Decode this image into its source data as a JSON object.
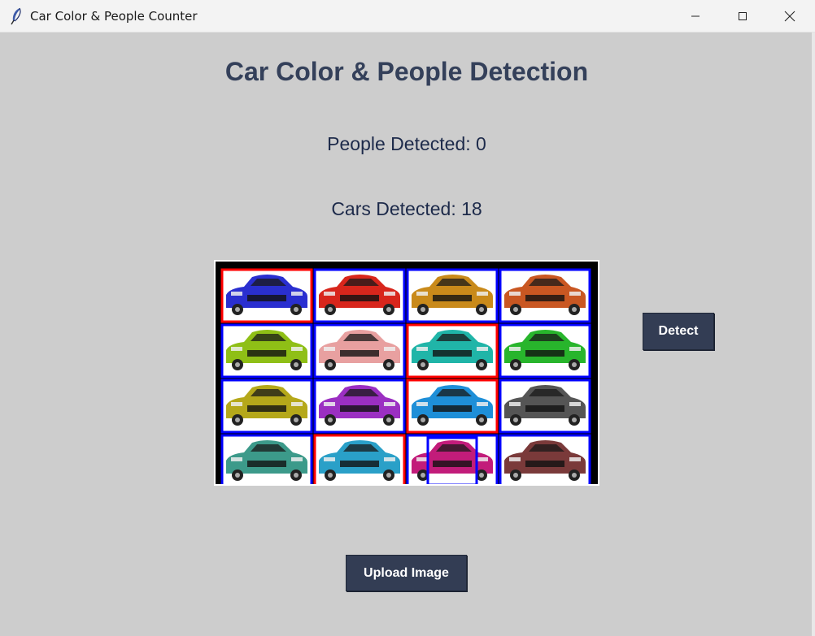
{
  "window": {
    "title": "Car Color & People Counter",
    "app_icon": "feather-icon",
    "controls": [
      "minimize-icon",
      "maximize-icon",
      "close-icon"
    ]
  },
  "main": {
    "heading": "Car Color & People Detection",
    "people_label": "People Detected: 0",
    "cars_label": "Cars Detected: 18",
    "detect_button": "Detect",
    "upload_button": "Upload Image"
  },
  "colors": {
    "background": "#cdcdcd",
    "heading": "#34405a",
    "button_bg": "#333d54",
    "button_text": "#ffffff",
    "box_red": "#ff0000",
    "box_blue": "#0000ff"
  },
  "image": {
    "car_colors": [
      [
        "#2a2fd0",
        "#d8261c",
        "#c98a1a",
        "#c95722"
      ],
      [
        "#8fbf16",
        "#e8a0a0",
        "#20b5a8",
        "#28b52c"
      ],
      [
        "#b5a81a",
        "#9b2fc2",
        "#1e8fd8",
        "#555555"
      ],
      [
        "#3c9a8a",
        "#2aa0c8",
        "#c21c7a",
        "#7a3a3a"
      ]
    ],
    "box_colors": [
      [
        "red",
        "blue",
        "blue",
        "blue"
      ],
      [
        "blue",
        "blue",
        "red",
        "blue"
      ],
      [
        "blue",
        "blue",
        "red",
        "blue"
      ],
      [
        "blue",
        "red",
        "blue",
        "blue"
      ]
    ]
  }
}
